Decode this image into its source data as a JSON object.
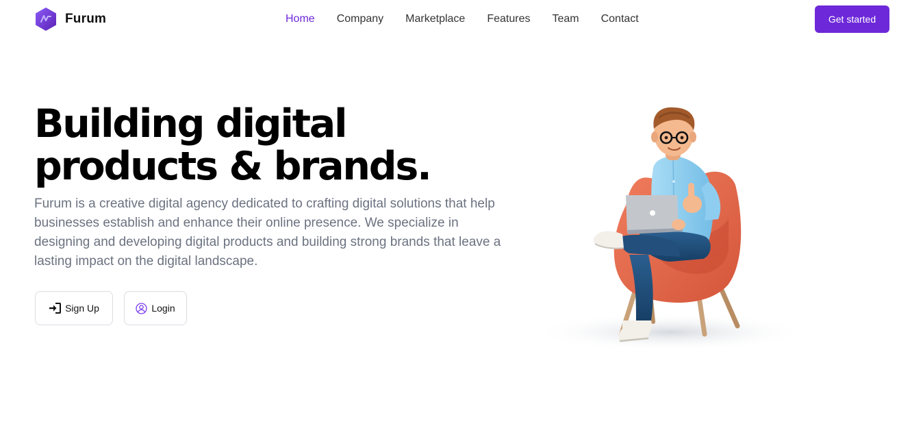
{
  "brand": {
    "name": "Furum",
    "logo_icon": "hexagon-bolt-icon",
    "color": "#6d28d9"
  },
  "nav": {
    "items": [
      {
        "label": "Home",
        "active": true
      },
      {
        "label": "Company",
        "active": false
      },
      {
        "label": "Marketplace",
        "active": false
      },
      {
        "label": "Features",
        "active": false
      },
      {
        "label": "Team",
        "active": false
      },
      {
        "label": "Contact",
        "active": false
      }
    ],
    "active_color": "#6d28d9"
  },
  "header": {
    "cta_label": "Get started"
  },
  "hero": {
    "title_line1": "Building digital",
    "title_line2": "products & brands.",
    "description": "Furum is a creative digital agency dedicated to crafting digital solutions that help businesses establish and enhance their online presence. We specialize in designing and developing digital products and building strong brands that leave a lasting impact on the digital landscape.",
    "signup_label": "Sign Up",
    "signup_icon": "sign-in-icon",
    "login_label": "Login",
    "login_icon": "user-circle-icon",
    "illustration": "man-in-armchair-with-laptop-illustration"
  },
  "colors": {
    "accent": "#6d28d9",
    "text_muted": "#6b7280",
    "chair": "#e8684a",
    "shirt": "#8ecdf0",
    "pants": "#1f4e79"
  }
}
